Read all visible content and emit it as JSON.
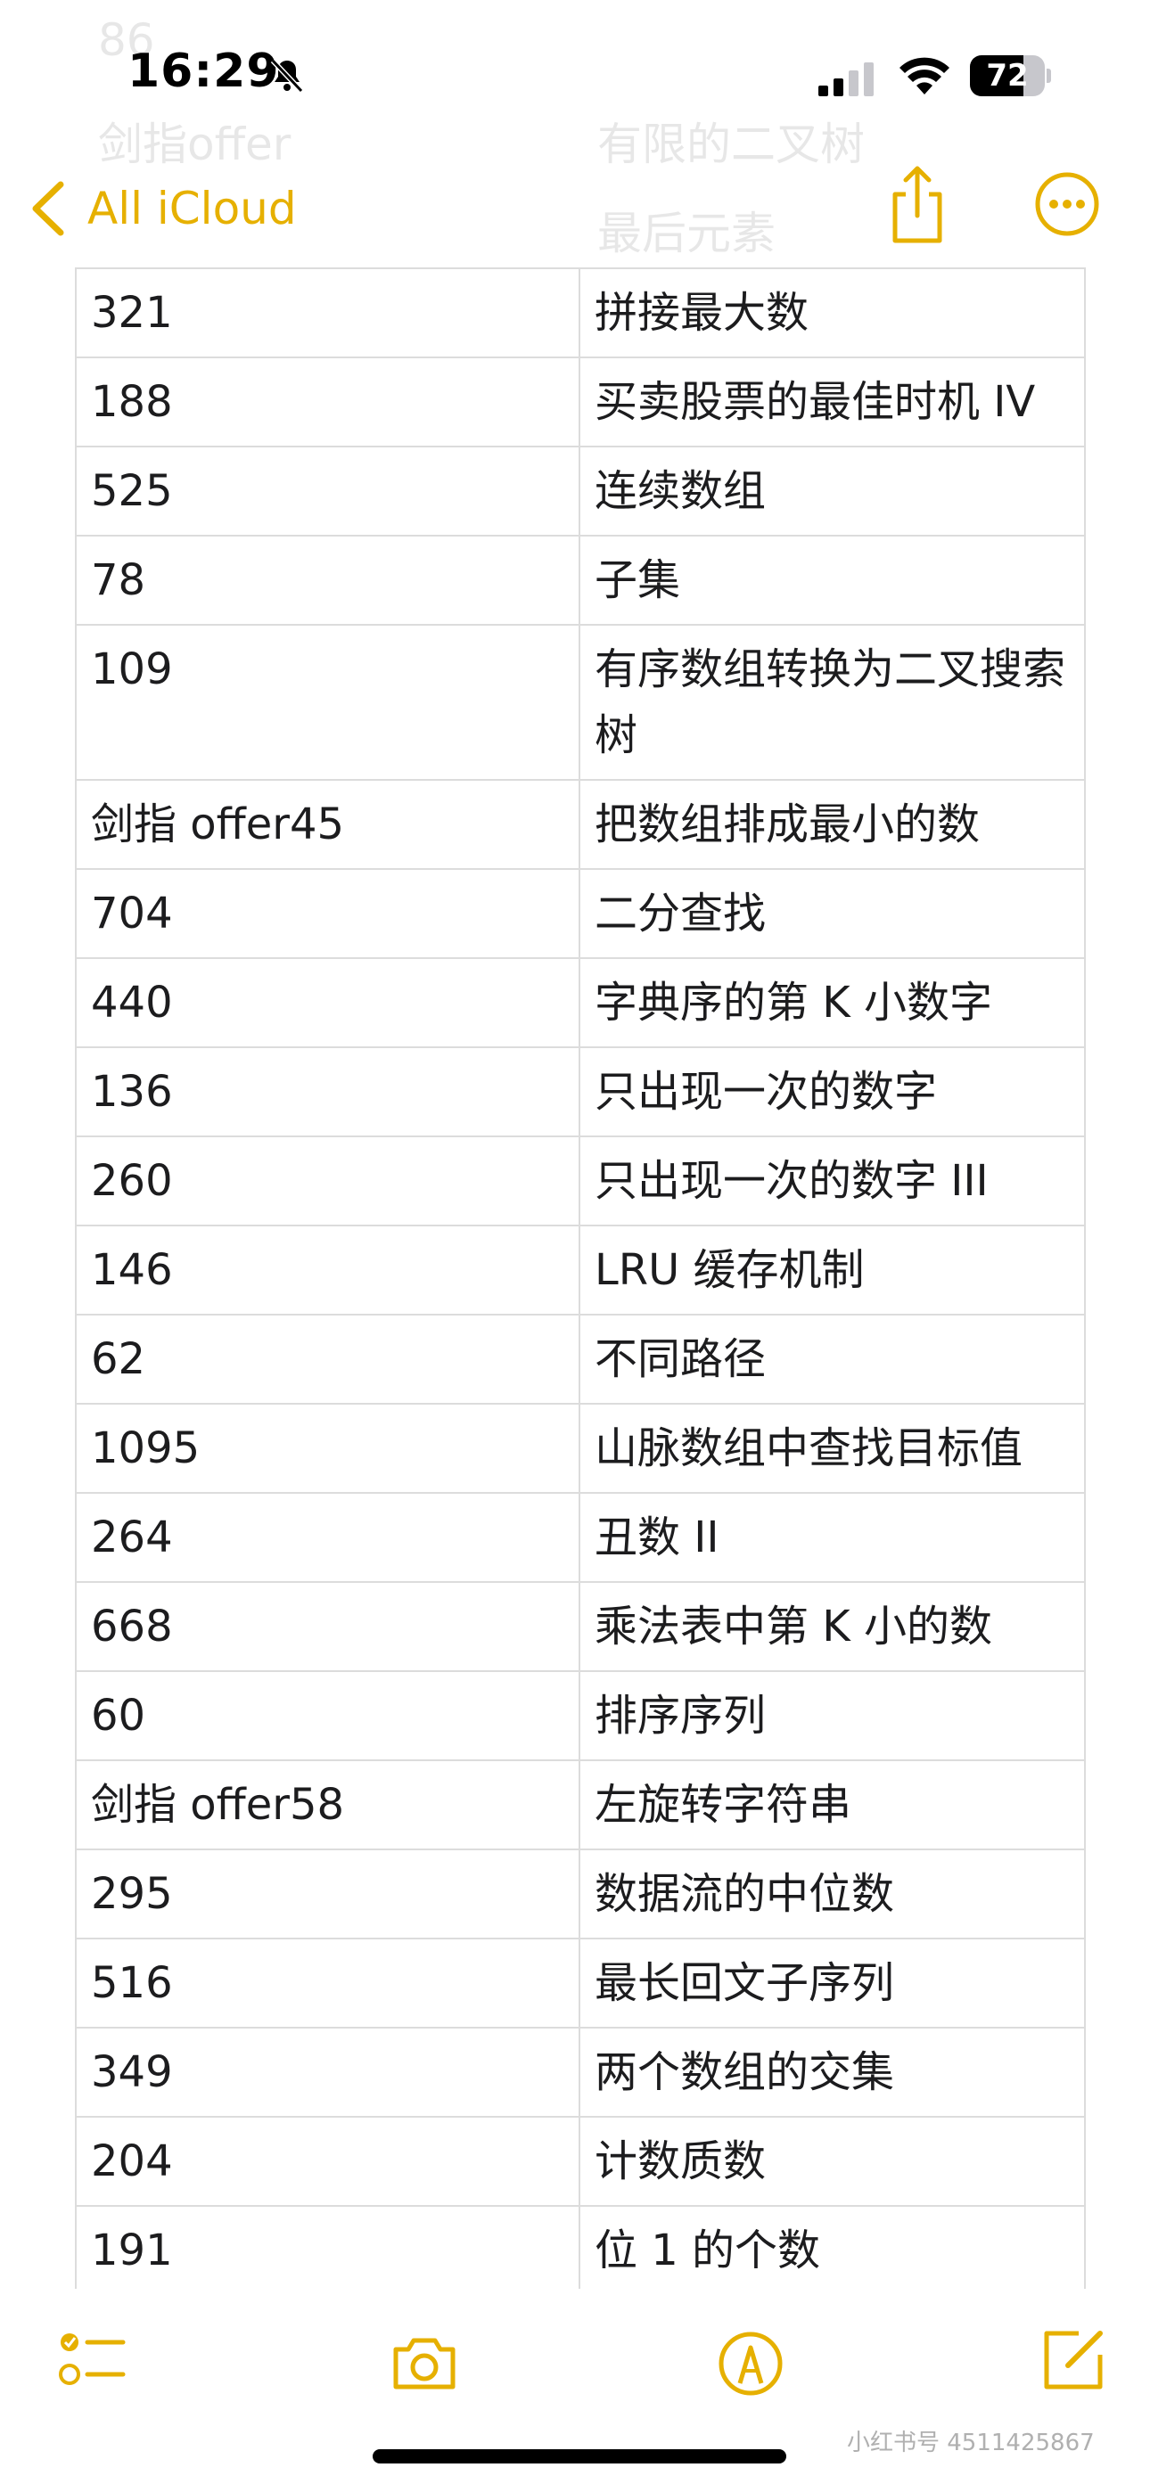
{
  "status_bar": {
    "time": "16:29",
    "battery": "72",
    "battery_level": 0.72
  },
  "ghost_rows": [
    "86",
    "剑指offer",
    "有限的二叉树",
    "最后元素"
  ],
  "nav": {
    "back_label": "All iCloud"
  },
  "table": {
    "rows": [
      [
        "321",
        "拼接最大数"
      ],
      [
        "188",
        "买卖股票的最佳时机 IV"
      ],
      [
        "525",
        "连续数组"
      ],
      [
        "78",
        "子集"
      ],
      [
        "109",
        "有序数组转换为二叉搜索树"
      ],
      [
        "剑指 offer45",
        "把数组排成最小的数"
      ],
      [
        "704",
        "二分查找"
      ],
      [
        "440",
        "字典序的第 K 小数字"
      ],
      [
        "136",
        "只出现一次的数字"
      ],
      [
        "260",
        "只出现一次的数字 III"
      ],
      [
        "146",
        "LRU 缓存机制"
      ],
      [
        "62",
        "不同路径"
      ],
      [
        "1095",
        "山脉数组中查找目标值"
      ],
      [
        "264",
        "丑数 II"
      ],
      [
        "668",
        "乘法表中第 K 小的数"
      ],
      [
        "60",
        "排序序列"
      ],
      [
        "剑指 offer58",
        "左旋转字符串"
      ],
      [
        "295",
        "数据流的中位数"
      ],
      [
        "516",
        "最长回文子序列"
      ],
      [
        "349",
        "两个数组的交集"
      ],
      [
        "204",
        "计数质数"
      ],
      [
        "191",
        "位 1 的个数"
      ],
      [
        "",
        ""
      ],
      [
        "",
        ""
      ]
    ]
  },
  "toolbar": {
    "icons": [
      "checklist-icon",
      "camera-icon",
      "markup-icon",
      "compose-icon"
    ]
  },
  "watermark": "小红书号 4511425867",
  "colors": {
    "accent": "#e6b000",
    "border": "#dcdcdc",
    "text": "#1c1c1e"
  }
}
